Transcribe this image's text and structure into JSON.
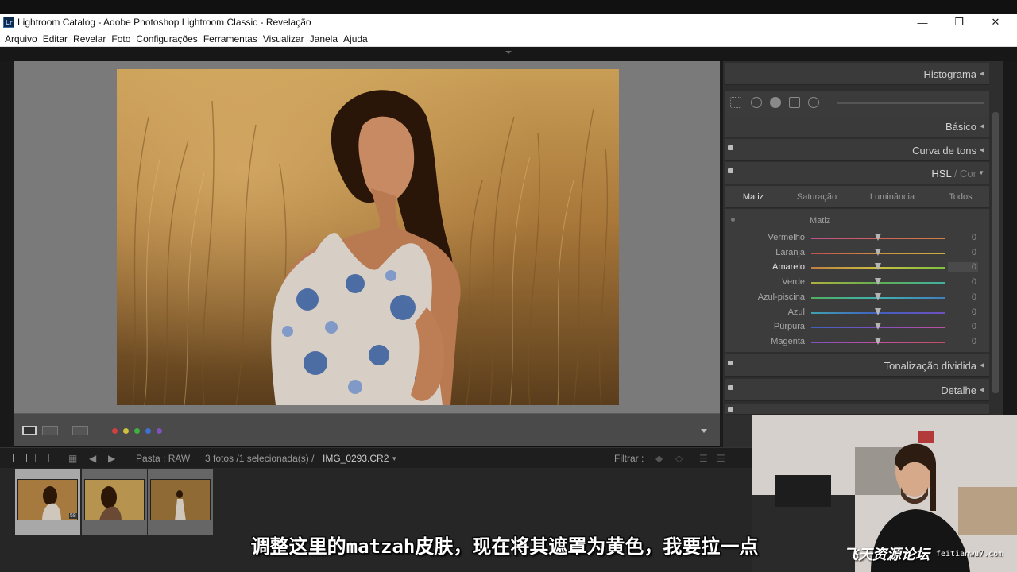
{
  "window": {
    "title": "Lightroom Catalog - Adobe Photoshop Lightroom Classic - Revelação",
    "minimize": "—",
    "maximize": "❐",
    "close": "✕"
  },
  "menu": [
    "Arquivo",
    "Editar",
    "Revelar",
    "Foto",
    "Configurações",
    "Ferramentas",
    "Visualizar",
    "Janela",
    "Ajuda"
  ],
  "panels": {
    "histograma": "Histograma",
    "basico": "Básico",
    "curva": "Curva de tons",
    "hsl": "HSL",
    "hsl_sep": " / ",
    "cor": "Cor",
    "tonalizacao": "Tonalização dividida",
    "detalhe": "Detalhe"
  },
  "hsl_tabs": [
    "Matiz",
    "Saturação",
    "Luminância",
    "Todos"
  ],
  "hsl_section_title": "Matiz",
  "hsl_sliders": [
    {
      "label": "Vermelho",
      "value": "0",
      "gradient": "linear-gradient(90deg,#c0508a,#d06060,#d08040)"
    },
    {
      "label": "Laranja",
      "value": "0",
      "gradient": "linear-gradient(90deg,#c05050,#d09040,#c8b040)"
    },
    {
      "label": "Amarelo",
      "value": "0",
      "gradient": "linear-gradient(90deg,#c08040,#c8c040,#80c040)"
    },
    {
      "label": "Verde",
      "value": "0",
      "gradient": "linear-gradient(90deg,#b0b040,#60b050,#40b0a0)"
    },
    {
      "label": "Azul-piscina",
      "value": "0",
      "gradient": "linear-gradient(90deg,#50b060,#40b0b0,#4080c0)"
    },
    {
      "label": "Azul",
      "value": "0",
      "gradient": "linear-gradient(90deg,#40a0b0,#4060c0,#7050c0)"
    },
    {
      "label": "Púrpura",
      "value": "0",
      "gradient": "linear-gradient(90deg,#4060c0,#8050c0,#c050a0)"
    },
    {
      "label": "Magenta",
      "value": "0",
      "gradient": "linear-gradient(90deg,#8050c0,#c050a0,#c05060)"
    }
  ],
  "filmstrip": {
    "folder": "Pasta : RAW",
    "count": "3 fotos /1 selecionada(s) /",
    "filename": "IMG_0293.CR2",
    "filename_arrow": "▾",
    "filter_label": "Filtrar :",
    "badge": "58"
  },
  "subtitle": "调整这里的matzah皮肤，现在将其遮罩为黄色，我要拉一点",
  "watermark": {
    "main": "飞天资源论坛",
    "url": "feitianwu7.com"
  },
  "colors": {
    "label_red": "#d04040",
    "label_yellow": "#d0c040",
    "label_green": "#40b040",
    "label_blue": "#4070d0",
    "label_purple": "#8050c0"
  }
}
